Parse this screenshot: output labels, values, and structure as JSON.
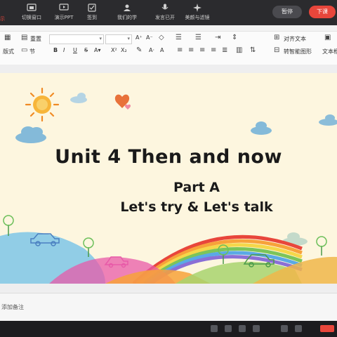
{
  "topbar": {
    "left_edge_label": "示",
    "items": [
      {
        "label": "切换窗口",
        "icon": "switch-window-icon"
      },
      {
        "label": "演示PPT",
        "icon": "present-icon"
      },
      {
        "label": "签到",
        "icon": "checkin-icon"
      },
      {
        "label": "我们的学",
        "icon": "people-icon"
      },
      {
        "label": "发言已开",
        "icon": "mic-icon"
      },
      {
        "label": "美颜与滤镜",
        "icon": "sparkle-icon"
      }
    ],
    "pause_label": "暂停",
    "end_label": "下课"
  },
  "ribbon": {
    "reset_label": "重置",
    "layout_label": "版式",
    "section_label": "节",
    "align_text_label": "对齐文本",
    "convert_label": "转智能图形",
    "textbox_label": "文本框"
  },
  "slide": {
    "title": "Unit 4 Then and now",
    "part": "Part A",
    "subtitle": "Let's try & Let's talk"
  },
  "notes": {
    "placeholder": "添加备注"
  },
  "colors": {
    "topbar_bg": "#2b2b2e",
    "end_button": "#e8463b",
    "slide_bg": "#fdf6df"
  }
}
